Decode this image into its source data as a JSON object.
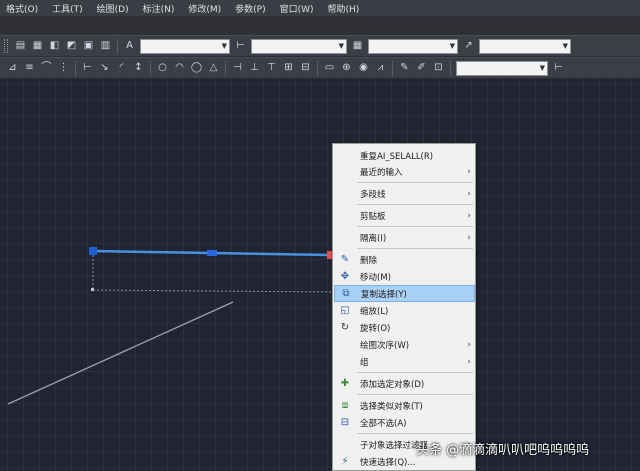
{
  "menubar": {
    "items": [
      "格式(O)",
      "工具(T)",
      "绘图(D)",
      "标注(N)",
      "修改(M)",
      "参数(P)",
      "窗口(W)",
      "帮助(H)"
    ]
  },
  "toolbar1": {
    "combo_text_style": "A",
    "combos": [
      "",
      "",
      "",
      "",
      ""
    ]
  },
  "toolbar2": {
    "combo_dim_style": ""
  },
  "context_menu": {
    "items": [
      {
        "label": "重复AI_SELALL(R)",
        "icon": "",
        "submenu": false
      },
      {
        "label": "最近的输入",
        "icon": "",
        "submenu": true
      },
      {
        "label": "多段线",
        "icon": "",
        "submenu": true
      },
      {
        "label": "剪贴板",
        "icon": "",
        "submenu": true
      },
      {
        "label": "隔离(I)",
        "icon": "",
        "submenu": true
      },
      {
        "label": "删除",
        "icon": "eraser-icon",
        "submenu": false
      },
      {
        "label": "移动(M)",
        "icon": "move-icon",
        "submenu": false
      },
      {
        "label": "复制选择(Y)",
        "icon": "copy-icon",
        "submenu": false,
        "highlighted": true
      },
      {
        "label": "缩放(L)",
        "icon": "scale-icon",
        "submenu": false
      },
      {
        "label": "旋转(O)",
        "icon": "rotate-icon",
        "submenu": false
      },
      {
        "label": "绘图次序(W)",
        "icon": "",
        "submenu": true
      },
      {
        "label": "组",
        "icon": "",
        "submenu": true
      },
      {
        "label": "添加选定对象(D)",
        "icon": "add-selected-icon",
        "submenu": false
      },
      {
        "label": "选择类似对象(T)",
        "icon": "select-similar-icon",
        "submenu": false
      },
      {
        "label": "全部不选(A)",
        "icon": "deselect-all-icon",
        "submenu": false
      },
      {
        "label": "子对象选择过滤器",
        "icon": "",
        "submenu": true
      },
      {
        "label": "快速选择(Q)...",
        "icon": "quick-select-icon",
        "submenu": false
      }
    ]
  },
  "watermark": {
    "text": "头条 @滴滴滴叭叭吧呜呜呜呜"
  },
  "colors": {
    "selected_line": "#4a90e2",
    "grip_blue": "#1f5fd6",
    "grip_red": "#e05050",
    "menu_highlight": "#a9d0f5"
  }
}
